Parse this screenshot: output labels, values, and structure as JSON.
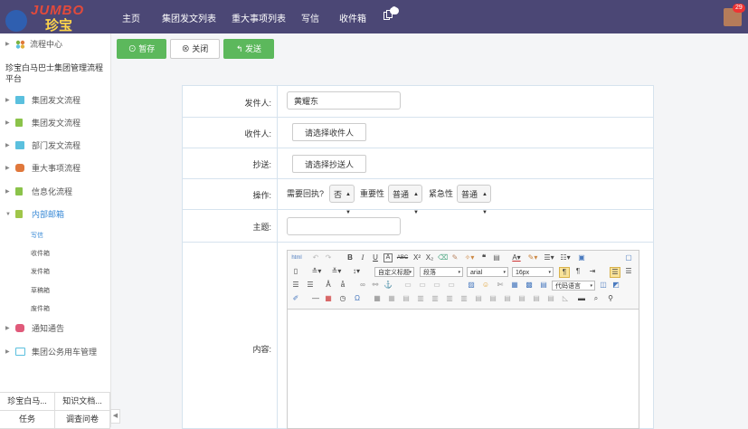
{
  "app": {
    "logo_top": "JUMBO",
    "logo_bottom": "珍宝"
  },
  "nav": {
    "items": [
      "主页",
      "集团发文列表",
      "重大事项列表",
      "写信",
      "收件箱"
    ],
    "copy_badge": "0",
    "avatar_badge": "29"
  },
  "sidebar": {
    "flow_center": "流程中心",
    "platform_title": "珍宝白马巴士集团管理流程平台",
    "items": [
      {
        "label": "集团发文流程",
        "icon": "doc-icon",
        "color": "#5bc0de"
      },
      {
        "label": "集团发文流程",
        "icon": "book-icon",
        "color": "#8bc34a"
      },
      {
        "label": "部门发文流程",
        "icon": "doc-icon",
        "color": "#5bc0de"
      },
      {
        "label": "重大事项流程",
        "icon": "stack-icon",
        "color": "#e0783c"
      },
      {
        "label": "信息化流程",
        "icon": "book-icon",
        "color": "#8bc34a"
      },
      {
        "label": "内部邮箱",
        "icon": "mail-icon",
        "color": "#a0c64a"
      },
      {
        "label": "通知通告",
        "icon": "chat-icon",
        "color": "#e05a7a"
      },
      {
        "label": "集团公务用车管理",
        "icon": "monitor-icon",
        "color": "#5bc0de"
      }
    ],
    "mail_sub": [
      "写信",
      "收件箱",
      "发件箱",
      "草稿箱",
      "废件箱"
    ],
    "bottom_tabs": [
      "珍宝白马...",
      "知识文档...",
      "任务",
      "调查问卷"
    ]
  },
  "toolbar": {
    "save": "暂存",
    "close": "关闭",
    "send": "发送"
  },
  "form": {
    "sender_label": "发件人:",
    "sender_value": "黄耀东",
    "receiver_label": "收件人:",
    "receiver_button": "请选择收件人",
    "cc_label": "抄送:",
    "cc_button": "请选择抄送人",
    "op_label": "操作:",
    "reply_label": "需要回执?",
    "reply_value": "否",
    "importance_label": "重要性",
    "importance_value": "普通",
    "urgency_label": "紧急性",
    "urgency_value": "普通",
    "subject_label": "主题:",
    "subject_value": "",
    "content_label": "内容:"
  },
  "editor": {
    "paragraph_format": "自定义标题",
    "paragraph": "段落",
    "font_family": "arial",
    "font_size": "16px",
    "code_language": "代码语言"
  }
}
